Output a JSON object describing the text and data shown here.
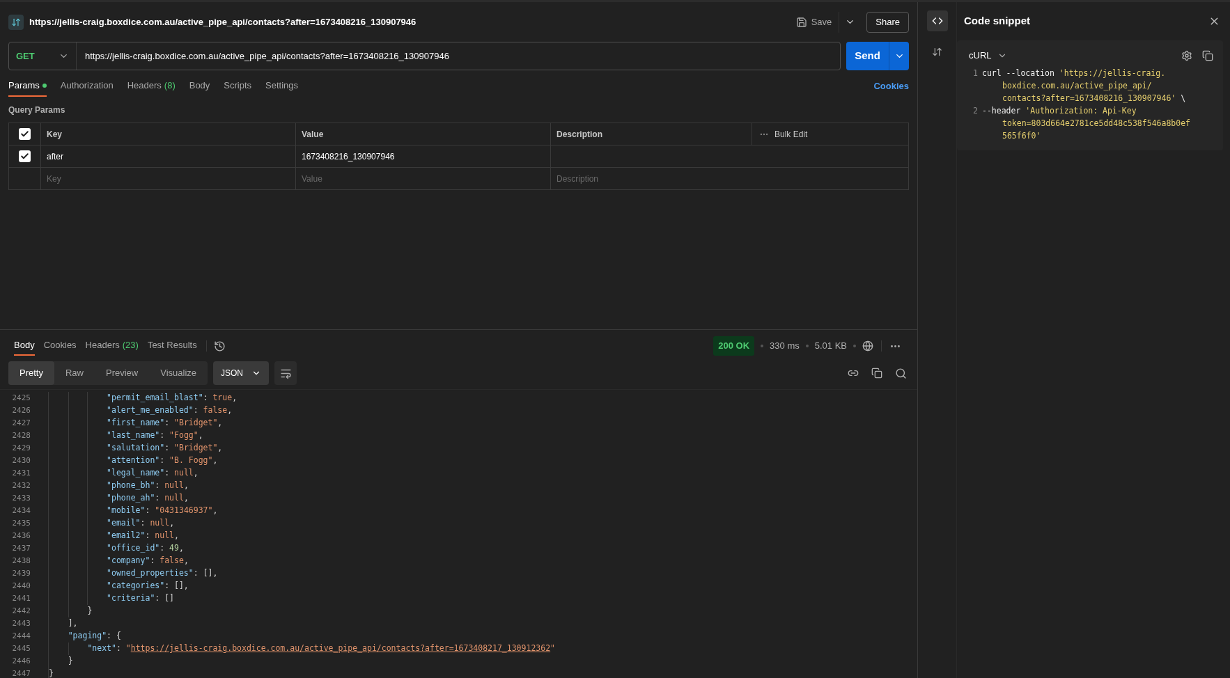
{
  "request": {
    "title": "https://jellis-craig.boxdice.com.au/active_pipe_api/contacts?after=1673408216_130907946",
    "method": "GET",
    "url": "https://jellis-craig.boxdice.com.au/active_pipe_api/contacts?after=1673408216_130907946",
    "save": "Save",
    "share": "Share",
    "send": "Send"
  },
  "request_tabs": [
    {
      "label": "Params",
      "dot": true,
      "selected": true
    },
    {
      "label": "Authorization",
      "dot": false,
      "selected": false
    },
    {
      "label": "Headers",
      "count": "(8)",
      "dot": false,
      "selected": false
    },
    {
      "label": "Body",
      "dot": false,
      "selected": false
    },
    {
      "label": "Scripts",
      "dot": false,
      "selected": false
    },
    {
      "label": "Settings",
      "dot": false,
      "selected": false
    }
  ],
  "cookies_link": "Cookies",
  "query_params": {
    "title": "Query Params",
    "columns": [
      "Key",
      "Value",
      "Description"
    ],
    "bulk_edit": "Bulk Edit",
    "all_checked": true,
    "rows": [
      {
        "checked": true,
        "key": "after",
        "value": "1673408216_130907946"
      }
    ],
    "placeholder": {
      "key": "Key",
      "value": "Value",
      "description": "Description"
    }
  },
  "response": {
    "tabs": [
      {
        "label": "Body",
        "selected": true
      },
      {
        "label": "Cookies",
        "selected": false
      },
      {
        "label": "Headers",
        "count": "(23)",
        "selected": false
      },
      {
        "label": "Test Results",
        "selected": false
      }
    ],
    "status": "200 OK",
    "time": "330 ms",
    "size": "5.01 KB",
    "view_modes": [
      {
        "label": "Pretty",
        "selected": true
      },
      {
        "label": "Raw",
        "selected": false
      },
      {
        "label": "Preview",
        "selected": false
      },
      {
        "label": "Visualize",
        "selected": false
      }
    ],
    "format": "JSON",
    "lines": [
      {
        "number": "2425",
        "segments": [
          {
            "kind": "key",
            "text": "            \"permit_email_blast\""
          },
          {
            "kind": "punct",
            "text": ": "
          },
          {
            "kind": "literal",
            "text": "true"
          },
          {
            "kind": "punct",
            "text": ","
          }
        ]
      },
      {
        "number": "2426",
        "segments": [
          {
            "kind": "key",
            "text": "            \"alert_me_enabled\""
          },
          {
            "kind": "punct",
            "text": ": "
          },
          {
            "kind": "literal",
            "text": "false"
          },
          {
            "kind": "punct",
            "text": ","
          }
        ]
      },
      {
        "number": "2427",
        "segments": [
          {
            "kind": "key",
            "text": "            \"first_name\""
          },
          {
            "kind": "punct",
            "text": ": "
          },
          {
            "kind": "string",
            "text": "\"Bridget\""
          },
          {
            "kind": "punct",
            "text": ","
          }
        ]
      },
      {
        "number": "2428",
        "segments": [
          {
            "kind": "key",
            "text": "            \"last_name\""
          },
          {
            "kind": "punct",
            "text": ": "
          },
          {
            "kind": "string",
            "text": "\"Fogg\""
          },
          {
            "kind": "punct",
            "text": ","
          }
        ]
      },
      {
        "number": "2429",
        "segments": [
          {
            "kind": "key",
            "text": "            \"salutation\""
          },
          {
            "kind": "punct",
            "text": ": "
          },
          {
            "kind": "string",
            "text": "\"Bridget\""
          },
          {
            "kind": "punct",
            "text": ","
          }
        ]
      },
      {
        "number": "2430",
        "segments": [
          {
            "kind": "key",
            "text": "            \"attention\""
          },
          {
            "kind": "punct",
            "text": ": "
          },
          {
            "kind": "string",
            "text": "\"B. Fogg\""
          },
          {
            "kind": "punct",
            "text": ","
          }
        ]
      },
      {
        "number": "2431",
        "segments": [
          {
            "kind": "key",
            "text": "            \"legal_name\""
          },
          {
            "kind": "punct",
            "text": ": "
          },
          {
            "kind": "literal",
            "text": "null"
          },
          {
            "kind": "punct",
            "text": ","
          }
        ]
      },
      {
        "number": "2432",
        "segments": [
          {
            "kind": "key",
            "text": "            \"phone_bh\""
          },
          {
            "kind": "punct",
            "text": ": "
          },
          {
            "kind": "literal",
            "text": "null"
          },
          {
            "kind": "punct",
            "text": ","
          }
        ]
      },
      {
        "number": "2433",
        "segments": [
          {
            "kind": "key",
            "text": "            \"phone_ah\""
          },
          {
            "kind": "punct",
            "text": ": "
          },
          {
            "kind": "literal",
            "text": "null"
          },
          {
            "kind": "punct",
            "text": ","
          }
        ]
      },
      {
        "number": "2434",
        "segments": [
          {
            "kind": "key",
            "text": "            \"mobile\""
          },
          {
            "kind": "punct",
            "text": ": "
          },
          {
            "kind": "string",
            "text": "\"0431346937\""
          },
          {
            "kind": "punct",
            "text": ","
          }
        ]
      },
      {
        "number": "2435",
        "segments": [
          {
            "kind": "key",
            "text": "            \"email\""
          },
          {
            "kind": "punct",
            "text": ": "
          },
          {
            "kind": "literal",
            "text": "null"
          },
          {
            "kind": "punct",
            "text": ","
          }
        ]
      },
      {
        "number": "2436",
        "segments": [
          {
            "kind": "key",
            "text": "            \"email2\""
          },
          {
            "kind": "punct",
            "text": ": "
          },
          {
            "kind": "literal",
            "text": "null"
          },
          {
            "kind": "punct",
            "text": ","
          }
        ]
      },
      {
        "number": "2437",
        "segments": [
          {
            "kind": "key",
            "text": "            \"office_id\""
          },
          {
            "kind": "punct",
            "text": ": "
          },
          {
            "kind": "number",
            "text": "49"
          },
          {
            "kind": "punct",
            "text": ","
          }
        ]
      },
      {
        "number": "2438",
        "segments": [
          {
            "kind": "key",
            "text": "            \"company\""
          },
          {
            "kind": "punct",
            "text": ": "
          },
          {
            "kind": "literal",
            "text": "false"
          },
          {
            "kind": "punct",
            "text": ","
          }
        ]
      },
      {
        "number": "2439",
        "segments": [
          {
            "kind": "key",
            "text": "            \"owned_properties\""
          },
          {
            "kind": "punct",
            "text": ": [],"
          }
        ]
      },
      {
        "number": "2440",
        "segments": [
          {
            "kind": "key",
            "text": "            \"categories\""
          },
          {
            "kind": "punct",
            "text": ": [],"
          }
        ]
      },
      {
        "number": "2441",
        "segments": [
          {
            "kind": "key",
            "text": "            \"criteria\""
          },
          {
            "kind": "punct",
            "text": ": []"
          }
        ]
      },
      {
        "number": "2442",
        "segments": [
          {
            "kind": "punct",
            "text": "        }"
          }
        ]
      },
      {
        "number": "2443",
        "segments": [
          {
            "kind": "punct",
            "text": "    ],"
          }
        ]
      },
      {
        "number": "2444",
        "segments": [
          {
            "kind": "key",
            "text": "    \"paging\""
          },
          {
            "kind": "punct",
            "text": ": {"
          }
        ]
      },
      {
        "number": "2445",
        "segments": [
          {
            "kind": "key",
            "text": "        \"next\""
          },
          {
            "kind": "punct",
            "text": ": "
          },
          {
            "kind": "string",
            "text": "\""
          },
          {
            "kind": "link",
            "text": "https://jellis-craig.boxdice.com.au/active_pipe_api/contacts?after=1673408217_130912362"
          },
          {
            "kind": "string",
            "text": "\""
          }
        ]
      },
      {
        "number": "2446",
        "segments": [
          {
            "kind": "punct",
            "text": "    }"
          }
        ]
      },
      {
        "number": "2447",
        "segments": [
          {
            "kind": "punct",
            "text": "}"
          }
        ]
      }
    ]
  },
  "snippet": {
    "title": "Code snippet",
    "language": "cURL",
    "lines": [
      {
        "number": "1",
        "segments": [
          {
            "kind": "plain",
            "text": "curl --location "
          },
          {
            "kind": "string",
            "text": "'https://jellis-craig."
          }
        ]
      },
      {
        "segments": [
          {
            "kind": "string",
            "text": "boxdice.com.au/active_pipe_api/"
          }
        ]
      },
      {
        "segments": [
          {
            "kind": "string",
            "text": "contacts?after=1673408216_130907946'"
          },
          {
            "kind": "plain",
            "text": " \\"
          }
        ]
      },
      {
        "number": "2",
        "segments": [
          {
            "kind": "plain",
            "text": "--header "
          },
          {
            "kind": "string",
            "text": "'Authorization: Api-Key"
          }
        ]
      },
      {
        "segments": [
          {
            "kind": "string",
            "text": "token=803d664e2781ce5dd48c538f546a8b0ef"
          }
        ]
      },
      {
        "segments": [
          {
            "kind": "string",
            "text": "565f6f0'"
          }
        ]
      }
    ]
  }
}
